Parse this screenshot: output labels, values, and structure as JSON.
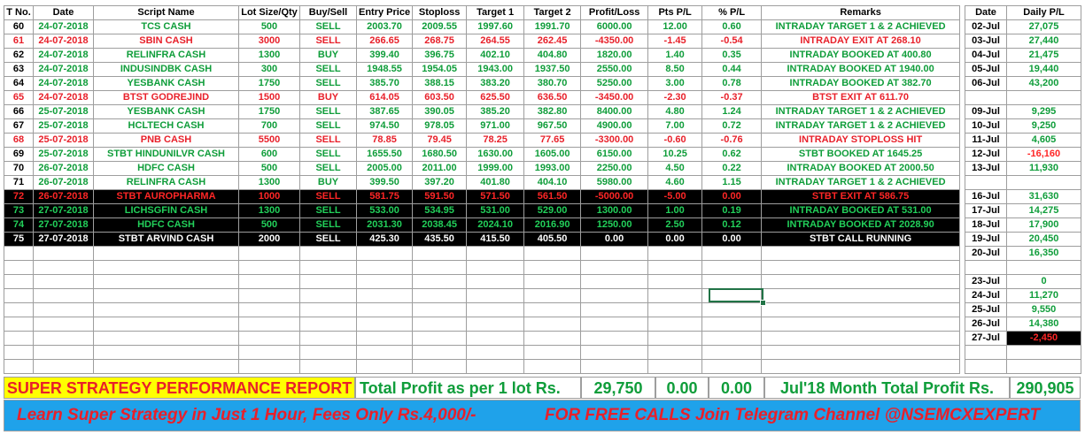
{
  "trades_table": {
    "headers": [
      "T No.",
      "Date",
      "Script Name",
      "Lot Size/Qty",
      "Buy/Sell",
      "Entry Price",
      "Stoploss",
      "Target 1",
      "Target 2",
      "Profit/Loss",
      "Pts P/L",
      "% P/L",
      "Remarks"
    ],
    "rows": [
      {
        "style": "g",
        "cells": [
          "60",
          "24-07-2018",
          "TCS CASH",
          "500",
          "SELL",
          "2003.70",
          "2009.55",
          "1997.60",
          "1991.70",
          "6000.00",
          "12.00",
          "0.60",
          "INTRADAY TARGET 1 & 2 ACHIEVED"
        ]
      },
      {
        "style": "r",
        "cells": [
          "61",
          "24-07-2018",
          "SBIN CASH",
          "3000",
          "SELL",
          "266.65",
          "268.75",
          "264.55",
          "262.45",
          "-4350.00",
          "-1.45",
          "-0.54",
          "INTRADAY EXIT AT 268.10"
        ]
      },
      {
        "style": "g",
        "cells": [
          "62",
          "24-07-2018",
          "RELINFRA CASH",
          "1300",
          "BUY",
          "399.40",
          "396.75",
          "402.10",
          "404.80",
          "1820.00",
          "1.40",
          "0.35",
          "INTRADAY BOOKED AT 400.80"
        ]
      },
      {
        "style": "g",
        "cells": [
          "63",
          "24-07-2018",
          "INDUSINDBK CASH",
          "300",
          "SELL",
          "1948.55",
          "1954.05",
          "1943.00",
          "1937.50",
          "2550.00",
          "8.50",
          "0.44",
          "INTRADAY BOOKED AT 1940.00"
        ]
      },
      {
        "style": "g",
        "cells": [
          "64",
          "24-07-2018",
          "YESBANK CASH",
          "1750",
          "SELL",
          "385.70",
          "388.15",
          "383.20",
          "380.70",
          "5250.00",
          "3.00",
          "0.78",
          "INTRADAY BOOKED AT 382.70"
        ]
      },
      {
        "style": "r",
        "cells": [
          "65",
          "24-07-2018",
          "BTST GODREJIND",
          "1500",
          "BUY",
          "614.05",
          "603.50",
          "625.50",
          "636.50",
          "-3450.00",
          "-2.30",
          "-0.37",
          "BTST EXIT AT 611.70"
        ]
      },
      {
        "style": "g",
        "cells": [
          "66",
          "25-07-2018",
          "YESBANK CASH",
          "1750",
          "SELL",
          "387.65",
          "390.05",
          "385.20",
          "382.80",
          "8400.00",
          "4.80",
          "1.24",
          "INTRADAY TARGET 1 & 2 ACHIEVED"
        ]
      },
      {
        "style": "g",
        "cells": [
          "67",
          "25-07-2018",
          "HCLTECH CASH",
          "700",
          "SELL",
          "974.50",
          "978.05",
          "971.00",
          "967.50",
          "4900.00",
          "7.00",
          "0.72",
          "INTRADAY TARGET 1 & 2 ACHIEVED"
        ]
      },
      {
        "style": "r",
        "cells": [
          "68",
          "25-07-2018",
          "PNB CASH",
          "5500",
          "SELL",
          "78.85",
          "79.45",
          "78.25",
          "77.65",
          "-3300.00",
          "-0.60",
          "-0.76",
          "INTRADAY STOPLOSS HIT"
        ]
      },
      {
        "style": "g",
        "cells": [
          "69",
          "25-07-2018",
          "STBT HINDUNILVR CASH",
          "600",
          "SELL",
          "1655.50",
          "1680.50",
          "1630.00",
          "1605.00",
          "6150.00",
          "10.25",
          "0.62",
          "STBT BOOKED AT 1645.25"
        ]
      },
      {
        "style": "g",
        "cells": [
          "70",
          "26-07-2018",
          "HDFC CASH",
          "500",
          "SELL",
          "2005.00",
          "2011.00",
          "1999.00",
          "1993.00",
          "2250.00",
          "4.50",
          "0.22",
          "INTRADAY BOOKED AT 2000.50"
        ]
      },
      {
        "style": "g",
        "cells": [
          "71",
          "26-07-2018",
          "RELINFRA CASH",
          "1300",
          "BUY",
          "399.50",
          "397.20",
          "401.80",
          "404.10",
          "5980.00",
          "4.60",
          "1.15",
          "INTRADAY TARGET 1 & 2 ACHIEVED"
        ]
      },
      {
        "style": "bk r",
        "cells": [
          "72",
          "26-07-2018",
          "STBT AUROPHARMA",
          "1000",
          "SELL",
          "581.75",
          "591.50",
          "571.50",
          "561.50",
          "-5000.00",
          "-5.00",
          "0.00",
          "STBT EXIT AT 586.75"
        ]
      },
      {
        "style": "bk g",
        "cells": [
          "73",
          "27-07-2018",
          "LICHSGFIN CASH",
          "1300",
          "SELL",
          "533.00",
          "534.95",
          "531.00",
          "529.00",
          "1300.00",
          "1.00",
          "0.19",
          "INTRADAY BOOKED AT 531.00"
        ]
      },
      {
        "style": "bk g",
        "cells": [
          "74",
          "27-07-2018",
          "HDFC CASH",
          "500",
          "SELL",
          "2031.30",
          "2038.45",
          "2024.10",
          "2016.90",
          "1250.00",
          "2.50",
          "0.12",
          "INTRADAY BOOKED AT 2028.90"
        ]
      },
      {
        "style": "bk w",
        "cells": [
          "75",
          "27-07-2018",
          "STBT ARVIND CASH",
          "2000",
          "SELL",
          "425.30",
          "435.50",
          "415.50",
          "405.50",
          "0.00",
          "0.00",
          "0.00",
          "STBT CALL RUNNING"
        ]
      }
    ],
    "empty_rows": 9
  },
  "daily_table": {
    "headers": [
      "Date",
      "Daily P/L"
    ],
    "rows": [
      {
        "date": "02-Jul",
        "pl": "27,075"
      },
      {
        "date": "03-Jul",
        "pl": "27,440"
      },
      {
        "date": "04-Jul",
        "pl": "21,475"
      },
      {
        "date": "05-Jul",
        "pl": "19,440"
      },
      {
        "date": "06-Jul",
        "pl": "43,200"
      },
      {
        "date": "",
        "pl": ""
      },
      {
        "date": "09-Jul",
        "pl": "9,295"
      },
      {
        "date": "10-Jul",
        "pl": "9,250"
      },
      {
        "date": "11-Jul",
        "pl": "4,605"
      },
      {
        "date": "12-Jul",
        "pl": "-16,160",
        "neg": true
      },
      {
        "date": "13-Jul",
        "pl": "11,930"
      },
      {
        "date": "",
        "pl": ""
      },
      {
        "date": "16-Jul",
        "pl": "31,630"
      },
      {
        "date": "17-Jul",
        "pl": "14,275"
      },
      {
        "date": "18-Jul",
        "pl": "17,900"
      },
      {
        "date": "19-Jul",
        "pl": "20,450"
      },
      {
        "date": "20-Jul",
        "pl": "16,350"
      },
      {
        "date": "",
        "pl": ""
      },
      {
        "date": "23-Jul",
        "pl": "0"
      },
      {
        "date": "24-Jul",
        "pl": "11,270"
      },
      {
        "date": "25-Jul",
        "pl": "9,550"
      },
      {
        "date": "26-Jul",
        "pl": "14,380"
      },
      {
        "date": "27-Jul",
        "pl": "-2,450",
        "neg": true,
        "dark": true
      },
      {
        "date": "",
        "pl": ""
      },
      {
        "date": "",
        "pl": ""
      }
    ]
  },
  "summary": {
    "report_title": "SUPER STRATEGY PERFORMANCE REPORT",
    "total_label": "Total Profit as per 1 lot Rs.",
    "total_value": "29,750",
    "pts_total": "0.00",
    "pct_total": "0.00",
    "month_label": "Jul'18 Month Total Profit Rs.",
    "month_value": "290,905"
  },
  "banner": {
    "left_text": "Learn Super Strategy in Just 1 Hour, Fees Only Rs.4,000/-",
    "right_text": "FOR FREE CALLS Join Telegram Channel @NSEMCXEXPERT"
  },
  "colors": {
    "profit_green": "#0f9d3a",
    "loss_red": "#e8202a",
    "title_bg": "#ffff00",
    "banner_bg": "#1fa2ea",
    "selection_green": "#217346"
  }
}
